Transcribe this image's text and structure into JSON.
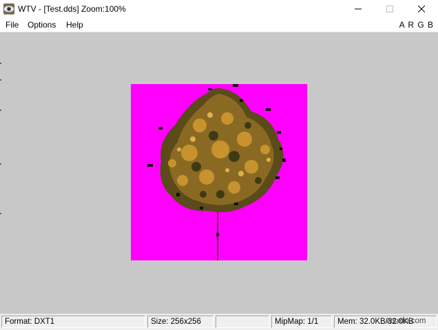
{
  "window": {
    "title": "WTV - [Test.dds] Zoom:100%",
    "app_icon": "eye-icon",
    "controls": [
      "minimize-icon",
      "maximize-icon",
      "close-icon"
    ]
  },
  "menu": {
    "items": [
      "File",
      "Options",
      "Help"
    ],
    "channels": "A R G B"
  },
  "canvas": {
    "background_color": "#c8c8c8",
    "texture_background_color": "#ff00ff",
    "content": "tree-texture-image"
  },
  "status": {
    "format": "Format: DXT1",
    "size": "Size: 256x256",
    "empty": "",
    "mipmap": "MipMap: 1/1",
    "mem": "Mem: 32.0KB/32.0KB",
    "overlay": "wsxdn.com"
  }
}
